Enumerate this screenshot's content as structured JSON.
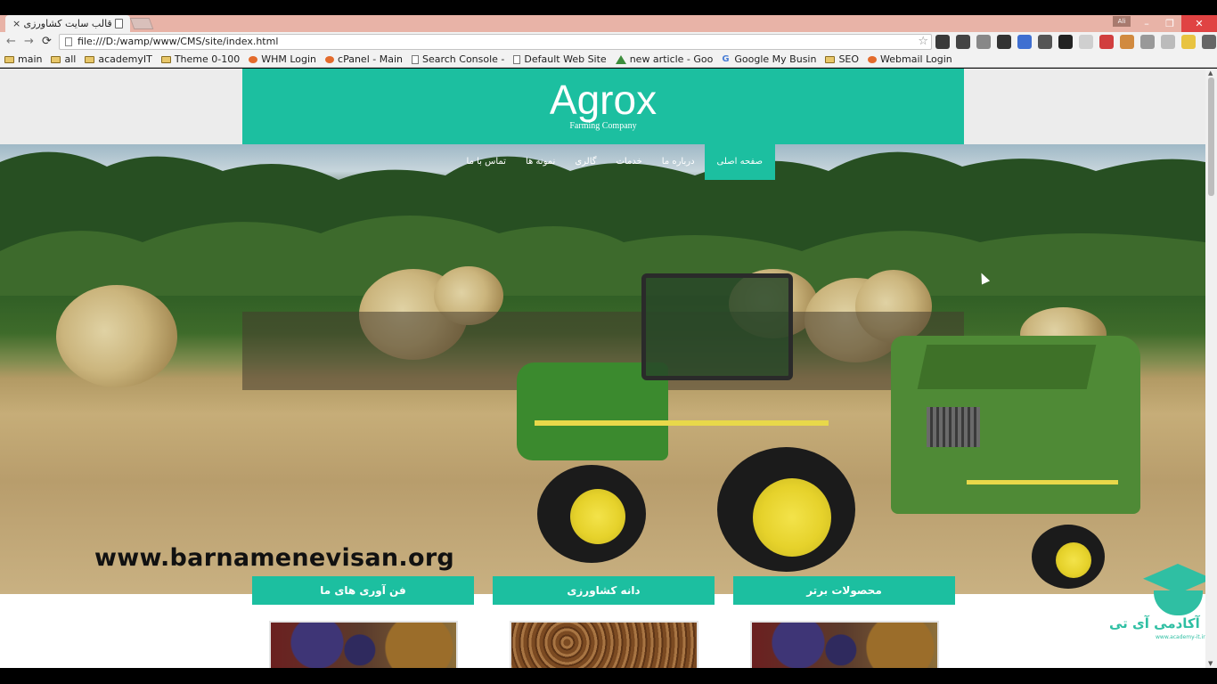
{
  "browser": {
    "tab_title": "قالب سایت کشاورزی",
    "tab_close": "×",
    "url": "file:///D:/wamp/www/CMS/site/index.html",
    "profile_badge": "Ali",
    "window_buttons": [
      "–",
      "❐",
      "✕"
    ],
    "nav": {
      "back": "←",
      "forward": "→",
      "reload": "⟳",
      "star": "☆"
    },
    "bookmarks": [
      {
        "label": "main",
        "icon": "folder-icon"
      },
      {
        "label": "all",
        "icon": "folder-icon"
      },
      {
        "label": "academyIT",
        "icon": "folder-icon"
      },
      {
        "label": "Theme 0-100",
        "icon": "folder-icon"
      },
      {
        "label": "WHM Login",
        "icon": "cpanel-icon"
      },
      {
        "label": "cPanel - Main",
        "icon": "cpanel-icon"
      },
      {
        "label": "Search Console -",
        "icon": "console-icon"
      },
      {
        "label": "Default Web Site",
        "icon": "page-icon"
      },
      {
        "label": "new article - Goo",
        "icon": "drive-icon"
      },
      {
        "label": "Google My Busin",
        "icon": "google-icon"
      },
      {
        "label": "SEO",
        "icon": "folder-icon"
      },
      {
        "label": "Webmail Login",
        "icon": "cpanel-icon"
      }
    ],
    "extension_colors": [
      "#3a3a3a",
      "#444444",
      "#888888",
      "#333333",
      "#3f6fd1",
      "#555555",
      "#222222",
      "#cfcfcf",
      "#d13f3f",
      "#d18a3f",
      "#999999",
      "#bbbbbb",
      "#e8c341",
      "#666666"
    ]
  },
  "site": {
    "logo": "Agrox",
    "tagline": "Farming Company",
    "menu": [
      {
        "label": "صفحه اصلی",
        "active": true
      },
      {
        "label": "درباره ما",
        "active": false
      },
      {
        "label": "خدمات",
        "active": false
      },
      {
        "label": "گالری",
        "active": false
      },
      {
        "label": "نمونه ها",
        "active": false
      },
      {
        "label": "تماس با ما",
        "active": false
      }
    ],
    "watermark": "www.barnamenevisan.org",
    "cards": [
      {
        "title": "محصولات برتر",
        "image": "fruit"
      },
      {
        "title": "دانه کشاورزی",
        "image": "beans"
      },
      {
        "title": "فن آوری های ما",
        "image": "fruit"
      }
    ],
    "academy_logo_text": "آکادمی آی تی",
    "academy_logo_url": "www.academy-it.ir",
    "accent_color": "#1cbfa0"
  }
}
